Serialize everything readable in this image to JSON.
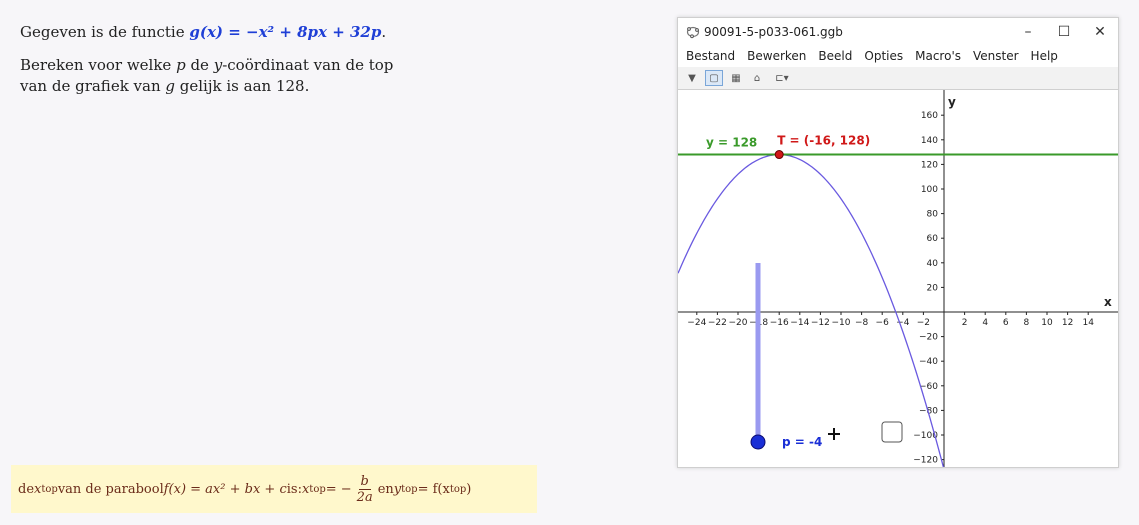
{
  "question": {
    "line1_prefix": "Gegeven is de functie ",
    "function": "g(x) = −x² + 8px + 32p",
    "line1_suffix": ".",
    "line2_a": "Bereken voor welke ",
    "var_p": "p",
    "line2_b": " de ",
    "var_y": "y",
    "line2_c": "-coördinaat van de top",
    "line3_a": "van de grafiek van ",
    "var_g": "g",
    "line3_b": " gelijk is aan 128."
  },
  "hint": {
    "prefix": "de ",
    "xtop": "x",
    "top_sub": "top",
    "middle": " van de parabool ",
    "formula": "f(x) = ax² + bx + c",
    "is": "  is:  ",
    "xtop_eq": " = −",
    "num": "b",
    "den": "2a",
    "en": "  en  ",
    "ytop": "y",
    "ytop_eq": " = f(x",
    "close": ")"
  },
  "window": {
    "title": "90091-5-p033-061.ggb",
    "minimize": "–",
    "maximize": "☐",
    "close": "✕",
    "menu": [
      "Bestand",
      "Bewerken",
      "Beeld",
      "Opties",
      "Macro's",
      "Venster",
      "Help"
    ]
  },
  "graph": {
    "x_axis_label": "x",
    "y_axis_label": "y",
    "x_ticks": [
      -24,
      -22,
      -20,
      -18,
      -16,
      -14,
      -12,
      -10,
      -8,
      -6,
      -4,
      -2,
      2,
      4,
      6,
      8,
      10,
      12,
      14
    ],
    "y_ticks": [
      160,
      140,
      120,
      100,
      80,
      60,
      40,
      20,
      -20,
      -40,
      -60,
      -80,
      -100,
      -120
    ],
    "line_label": "y = 128",
    "line_y": 128,
    "point_label": "T = (-16, 128)",
    "point": [
      -16,
      128
    ],
    "slider_label": "p = -4",
    "p": -4,
    "colors": {
      "curve": "#6a5ae0",
      "line": "#3a9a2a",
      "point": "#d01818",
      "slider": "#1a2fd6"
    }
  }
}
